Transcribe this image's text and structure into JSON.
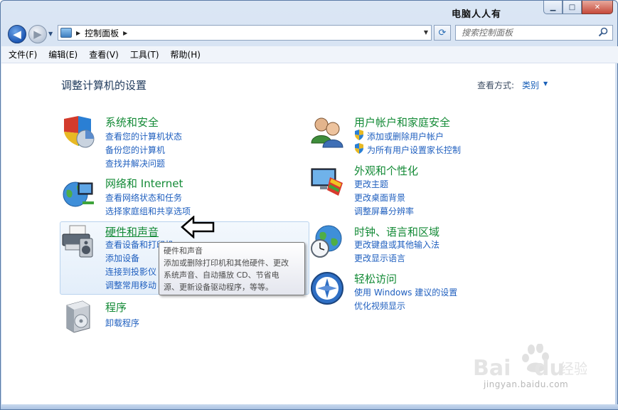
{
  "window": {
    "title_watermark": "电脑人人有",
    "buttons": {
      "minimize": "▁",
      "maximize": "□",
      "close": "✕"
    }
  },
  "nav": {
    "back_glyph": "◀",
    "forward_glyph": "▶",
    "address": {
      "path": "控制面板"
    },
    "search": {
      "placeholder": "搜索控制面板"
    }
  },
  "menu": [
    "文件(F)",
    "编辑(E)",
    "查看(V)",
    "工具(T)",
    "帮助(H)"
  ],
  "main": {
    "title": "调整计算机的设置",
    "view_label": "查看方式:",
    "view_value": "类别"
  },
  "categories": {
    "system": {
      "title": "系统和安全",
      "links": [
        "查看您的计算机状态",
        "备份您的计算机",
        "查找并解决问题"
      ]
    },
    "network": {
      "title": "网络和 Internet",
      "links": [
        "查看网络状态和任务",
        "选择家庭组和共享选项"
      ]
    },
    "hardware": {
      "title": "硬件和声音",
      "links": [
        "查看设备和打印机",
        "添加设备",
        "连接到投影仪",
        "调整常用移动"
      ]
    },
    "programs": {
      "title": "程序",
      "links": [
        "卸载程序"
      ]
    },
    "users": {
      "title": "用户帐户和家庭安全",
      "links": [
        "添加或删除用户帐户",
        "为所有用户设置家长控制"
      ]
    },
    "appearance": {
      "title": "外观和个性化",
      "links": [
        "更改主题",
        "更改桌面背景",
        "调整屏幕分辨率"
      ]
    },
    "clock": {
      "title": "时钟、语言和区域",
      "links": [
        "更改键盘或其他输入法",
        "更改显示语言"
      ]
    },
    "ease": {
      "title": "轻松访问",
      "links": [
        "使用 Windows 建议的设置",
        "优化视频显示"
      ]
    }
  },
  "tooltip": {
    "title": "硬件和声音",
    "lines": [
      "添加或删除打印机和其他硬件、更改",
      "系统声音、自动播放 CD、节省电",
      "源、更新设备驱动程序，等等。"
    ]
  },
  "watermark": {
    "url": "jingyan.baidu.com"
  },
  "colors": {
    "category_title": "#138a36",
    "link": "#1f5fbf",
    "heading": "#1e395b"
  }
}
